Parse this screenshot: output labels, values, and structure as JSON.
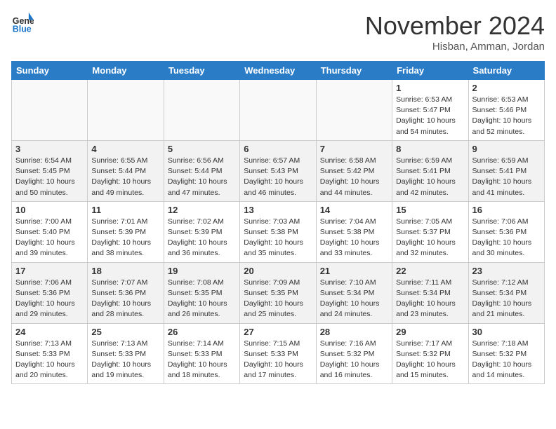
{
  "header": {
    "logo_line1": "General",
    "logo_line2": "Blue",
    "month": "November 2024",
    "location": "Hisban, Amman, Jordan"
  },
  "weekdays": [
    "Sunday",
    "Monday",
    "Tuesday",
    "Wednesday",
    "Thursday",
    "Friday",
    "Saturday"
  ],
  "weeks": [
    [
      {
        "day": "",
        "info": ""
      },
      {
        "day": "",
        "info": ""
      },
      {
        "day": "",
        "info": ""
      },
      {
        "day": "",
        "info": ""
      },
      {
        "day": "",
        "info": ""
      },
      {
        "day": "1",
        "info": "Sunrise: 6:53 AM\nSunset: 5:47 PM\nDaylight: 10 hours\nand 54 minutes."
      },
      {
        "day": "2",
        "info": "Sunrise: 6:53 AM\nSunset: 5:46 PM\nDaylight: 10 hours\nand 52 minutes."
      }
    ],
    [
      {
        "day": "3",
        "info": "Sunrise: 6:54 AM\nSunset: 5:45 PM\nDaylight: 10 hours\nand 50 minutes."
      },
      {
        "day": "4",
        "info": "Sunrise: 6:55 AM\nSunset: 5:44 PM\nDaylight: 10 hours\nand 49 minutes."
      },
      {
        "day": "5",
        "info": "Sunrise: 6:56 AM\nSunset: 5:44 PM\nDaylight: 10 hours\nand 47 minutes."
      },
      {
        "day": "6",
        "info": "Sunrise: 6:57 AM\nSunset: 5:43 PM\nDaylight: 10 hours\nand 46 minutes."
      },
      {
        "day": "7",
        "info": "Sunrise: 6:58 AM\nSunset: 5:42 PM\nDaylight: 10 hours\nand 44 minutes."
      },
      {
        "day": "8",
        "info": "Sunrise: 6:59 AM\nSunset: 5:41 PM\nDaylight: 10 hours\nand 42 minutes."
      },
      {
        "day": "9",
        "info": "Sunrise: 6:59 AM\nSunset: 5:41 PM\nDaylight: 10 hours\nand 41 minutes."
      }
    ],
    [
      {
        "day": "10",
        "info": "Sunrise: 7:00 AM\nSunset: 5:40 PM\nDaylight: 10 hours\nand 39 minutes."
      },
      {
        "day": "11",
        "info": "Sunrise: 7:01 AM\nSunset: 5:39 PM\nDaylight: 10 hours\nand 38 minutes."
      },
      {
        "day": "12",
        "info": "Sunrise: 7:02 AM\nSunset: 5:39 PM\nDaylight: 10 hours\nand 36 minutes."
      },
      {
        "day": "13",
        "info": "Sunrise: 7:03 AM\nSunset: 5:38 PM\nDaylight: 10 hours\nand 35 minutes."
      },
      {
        "day": "14",
        "info": "Sunrise: 7:04 AM\nSunset: 5:38 PM\nDaylight: 10 hours\nand 33 minutes."
      },
      {
        "day": "15",
        "info": "Sunrise: 7:05 AM\nSunset: 5:37 PM\nDaylight: 10 hours\nand 32 minutes."
      },
      {
        "day": "16",
        "info": "Sunrise: 7:06 AM\nSunset: 5:36 PM\nDaylight: 10 hours\nand 30 minutes."
      }
    ],
    [
      {
        "day": "17",
        "info": "Sunrise: 7:06 AM\nSunset: 5:36 PM\nDaylight: 10 hours\nand 29 minutes."
      },
      {
        "day": "18",
        "info": "Sunrise: 7:07 AM\nSunset: 5:36 PM\nDaylight: 10 hours\nand 28 minutes."
      },
      {
        "day": "19",
        "info": "Sunrise: 7:08 AM\nSunset: 5:35 PM\nDaylight: 10 hours\nand 26 minutes."
      },
      {
        "day": "20",
        "info": "Sunrise: 7:09 AM\nSunset: 5:35 PM\nDaylight: 10 hours\nand 25 minutes."
      },
      {
        "day": "21",
        "info": "Sunrise: 7:10 AM\nSunset: 5:34 PM\nDaylight: 10 hours\nand 24 minutes."
      },
      {
        "day": "22",
        "info": "Sunrise: 7:11 AM\nSunset: 5:34 PM\nDaylight: 10 hours\nand 23 minutes."
      },
      {
        "day": "23",
        "info": "Sunrise: 7:12 AM\nSunset: 5:34 PM\nDaylight: 10 hours\nand 21 minutes."
      }
    ],
    [
      {
        "day": "24",
        "info": "Sunrise: 7:13 AM\nSunset: 5:33 PM\nDaylight: 10 hours\nand 20 minutes."
      },
      {
        "day": "25",
        "info": "Sunrise: 7:13 AM\nSunset: 5:33 PM\nDaylight: 10 hours\nand 19 minutes."
      },
      {
        "day": "26",
        "info": "Sunrise: 7:14 AM\nSunset: 5:33 PM\nDaylight: 10 hours\nand 18 minutes."
      },
      {
        "day": "27",
        "info": "Sunrise: 7:15 AM\nSunset: 5:33 PM\nDaylight: 10 hours\nand 17 minutes."
      },
      {
        "day": "28",
        "info": "Sunrise: 7:16 AM\nSunset: 5:32 PM\nDaylight: 10 hours\nand 16 minutes."
      },
      {
        "day": "29",
        "info": "Sunrise: 7:17 AM\nSunset: 5:32 PM\nDaylight: 10 hours\nand 15 minutes."
      },
      {
        "day": "30",
        "info": "Sunrise: 7:18 AM\nSunset: 5:32 PM\nDaylight: 10 hours\nand 14 minutes."
      }
    ]
  ]
}
